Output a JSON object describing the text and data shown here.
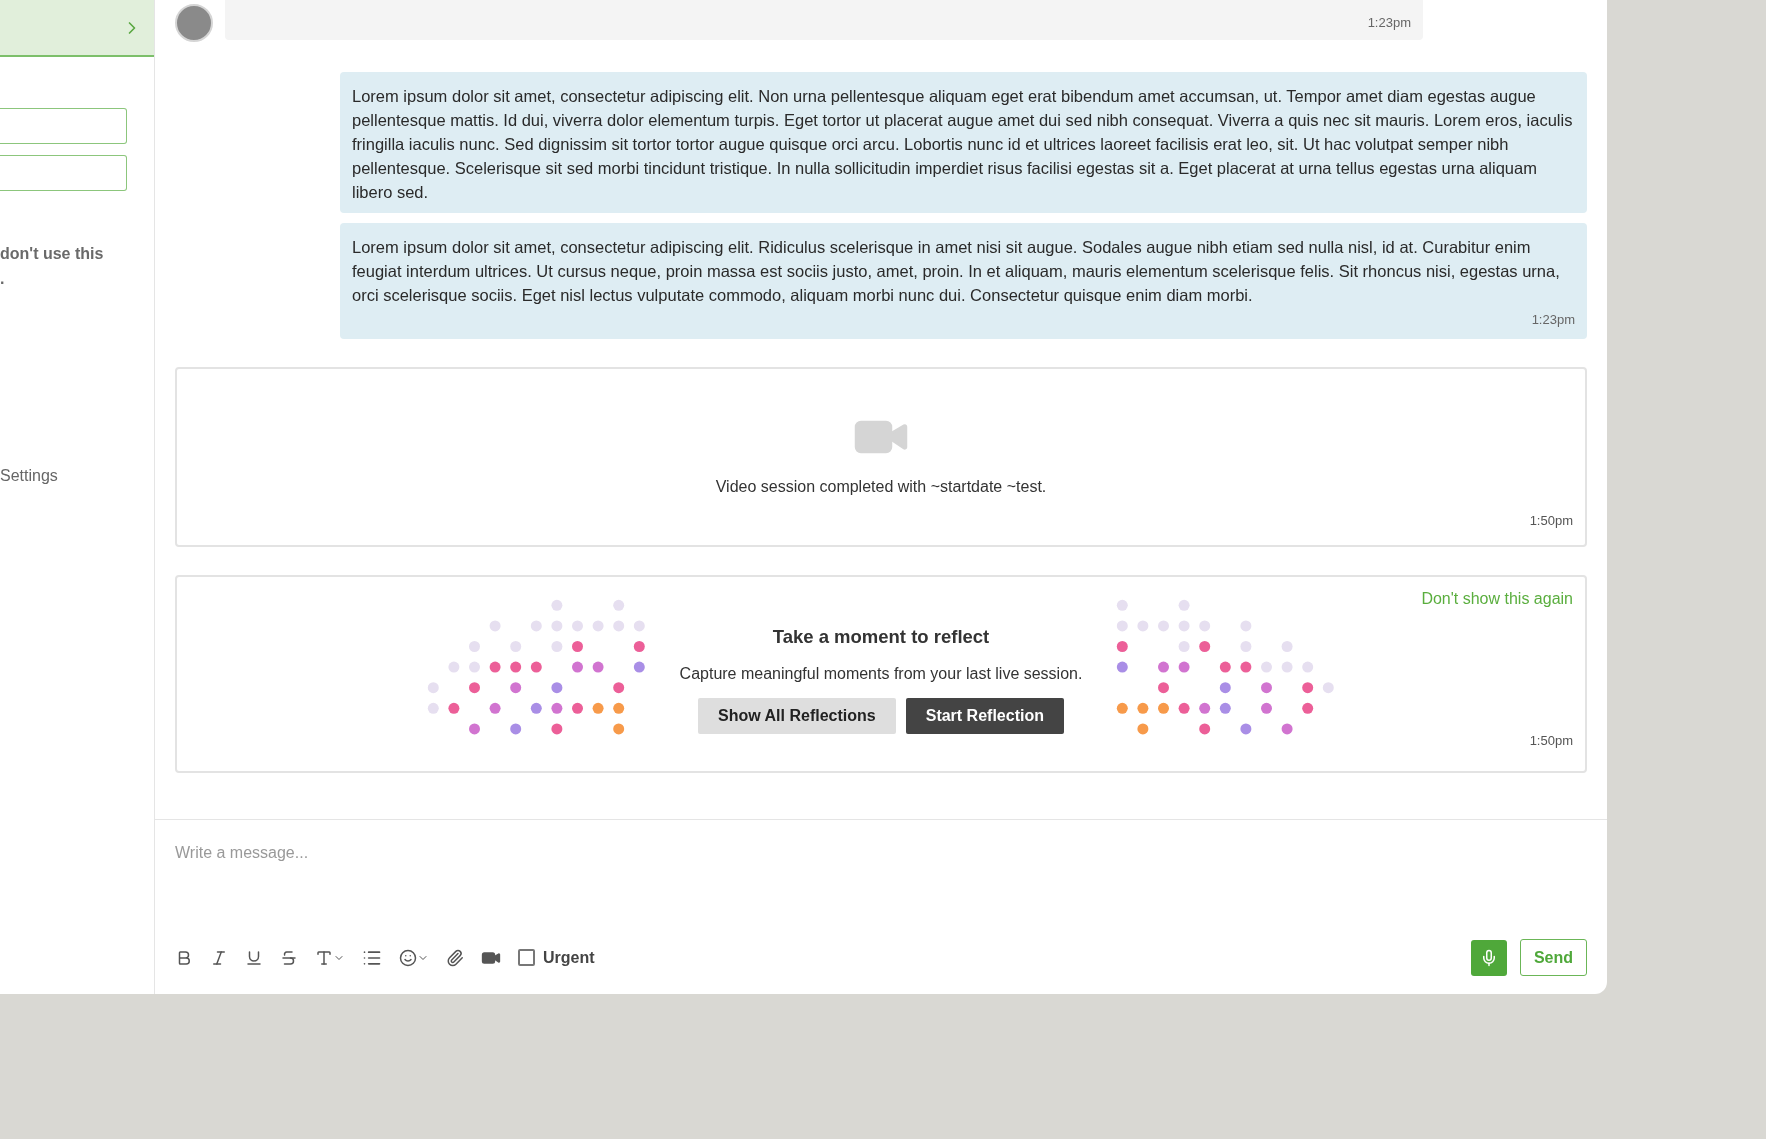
{
  "sidebar": {
    "note_lines": [
      "don't use this",
      "."
    ],
    "settings_label": "Settings"
  },
  "messages": [
    {
      "kind": "incoming",
      "time": "1:23pm"
    },
    {
      "kind": "outgoing",
      "text": "Lorem ipsum dolor sit amet, consectetur adipiscing elit. Non urna pellentesque aliquam eget erat bibendum amet accumsan, ut. Tempor amet diam egestas augue pellentesque mattis. Id dui, viverra dolor elementum turpis. Eget tortor ut placerat augue amet dui sed nibh consequat. Viverra a quis nec sit mauris. Lorem eros, iaculis fringilla iaculis nunc. Sed dignissim sit tortor tortor augue quisque orci arcu. Lobortis nunc id et ultrices laoreet facilisis erat leo, sit. Ut hac volutpat semper nibh pellentesque. Scelerisque sit sed morbi tincidunt tristique. In nulla sollicitudin imperdiet risus facilisi egestas sit a. Eget placerat at urna tellus egestas urna aliquam libero sed."
    },
    {
      "kind": "outgoing",
      "text": "Lorem ipsum dolor sit amet, consectetur adipiscing elit. Ridiculus scelerisque in amet nisi sit augue. Sodales augue nibh etiam sed nulla nisl, id at. Curabitur enim feugiat interdum ultrices. Ut cursus neque, proin massa est sociis justo, amet, proin. In et aliquam, mauris elementum scelerisque felis. Sit rhoncus nisi, egestas urna, orci scelerisque sociis. Eget nisl lectus vulputate commodo, aliquam morbi nunc dui. Consectetur quisque enim diam morbi.",
      "time": "1:23pm"
    }
  ],
  "video_session": {
    "text": "Video session completed with ~startdate ~test.",
    "time": "1:50pm"
  },
  "reflection": {
    "dismiss_link": "Don't show this again",
    "title": "Take a moment to reflect",
    "subtitle": "Capture meaningful moments from your last live session.",
    "buttons": [
      {
        "label": "Show All Reflections",
        "kind": "secondary"
      },
      {
        "label": "Start Reflection",
        "kind": "primary"
      }
    ],
    "time": "1:50pm"
  },
  "composer": {
    "placeholder": "Write a message...",
    "urgent": {
      "label": "Urgent",
      "checked": false
    },
    "send": "Send"
  }
}
